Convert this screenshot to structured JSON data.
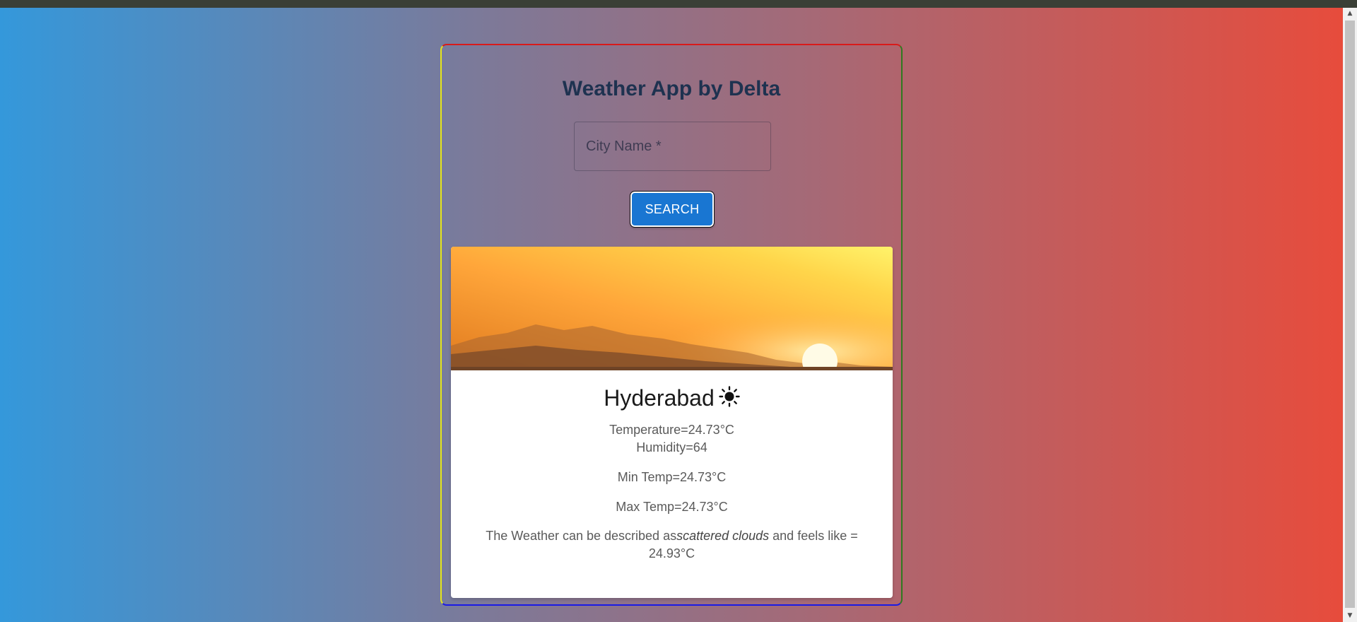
{
  "header": {
    "title": "Weather App by Delta"
  },
  "search": {
    "placeholder": "City Name *",
    "value": "",
    "button_label": "SEARCH"
  },
  "weather": {
    "city": "Hyderabad",
    "icon": "sun-icon",
    "temperature_line": "Temperature=24.73°C",
    "humidity_line": "Humidity=64",
    "min_temp_line": "Min Temp=24.73°C",
    "max_temp_line": "Max Temp=24.73°C",
    "desc_prefix": "The Weather can be described as",
    "description": "scattered clouds",
    "desc_suffix": " and feels like = 24.93°C"
  },
  "colors": {
    "gradient_start": "#3498db",
    "gradient_end": "#e74c3c",
    "title": "#1e3250",
    "button": "#1976d2"
  }
}
